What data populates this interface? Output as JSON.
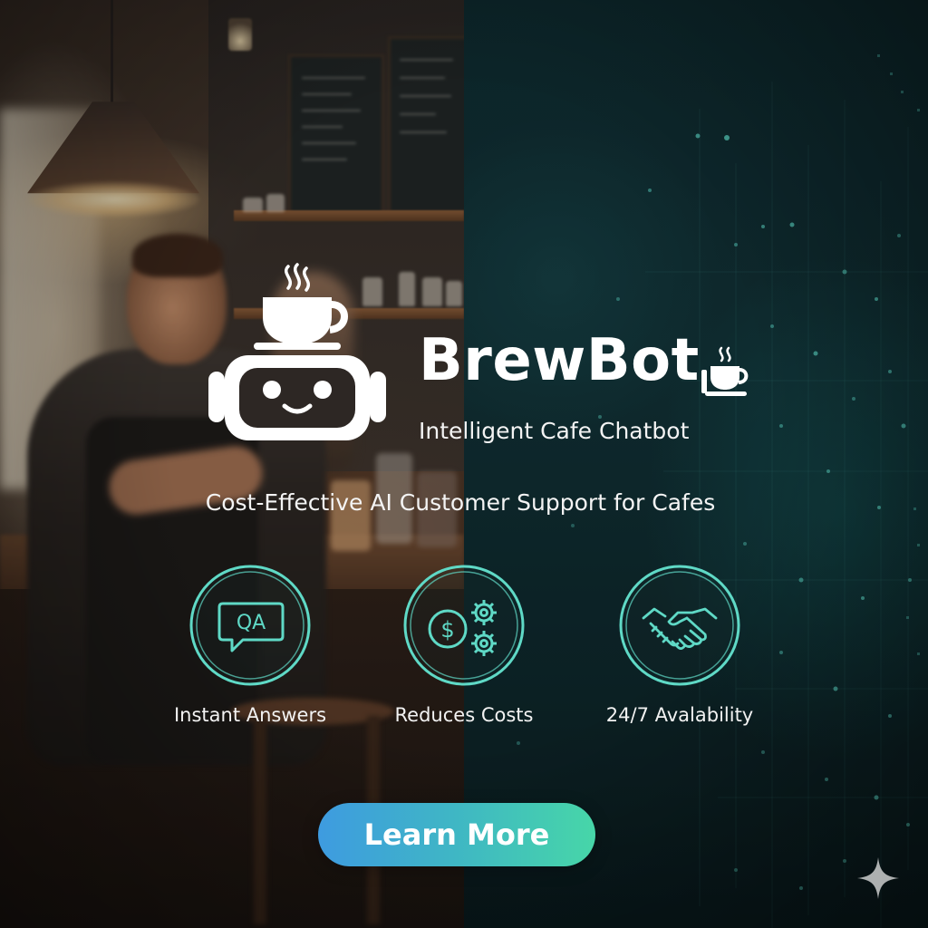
{
  "brand": {
    "name": "BrewBot",
    "subtitle": "Intelligent Cafe Chatbot",
    "tagline": "Cost-Effective AI Customer Support for Cafes"
  },
  "features": [
    {
      "icon": "qa-chat-bubble-icon",
      "icon_text": "QA",
      "label": "Instant Answers"
    },
    {
      "icon": "dollar-gears-icon",
      "icon_text": "$",
      "label": "Reduces Costs"
    },
    {
      "icon": "handshake-icon",
      "label": "24/7 Avalability"
    }
  ],
  "cta": {
    "label": "Learn More"
  },
  "colors": {
    "accent_teal": "#5fd9c6",
    "cta_gradient_start": "#3e9be0",
    "cta_gradient_end": "#47d6a8",
    "cafe_tone": "#3b2c22",
    "tech_tone": "#0f3035"
  }
}
